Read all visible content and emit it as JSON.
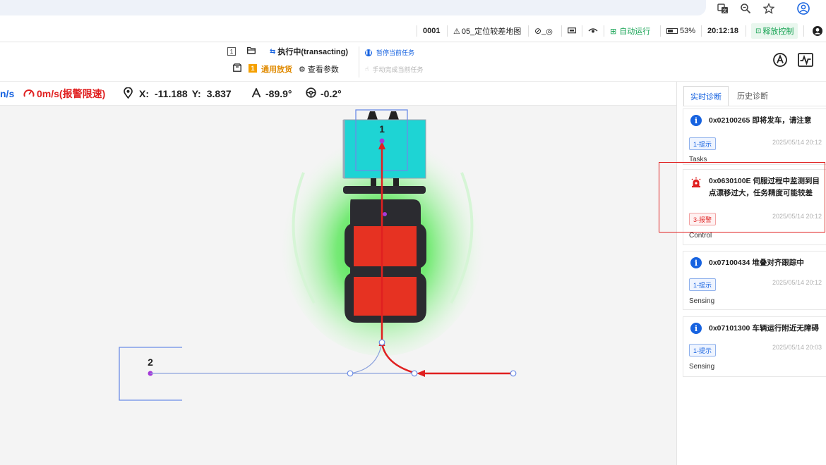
{
  "status_bar": {
    "vehicle_id": "0001",
    "map_name": "05_定位较差地图",
    "site_label": "_",
    "mode": "自动运行",
    "battery": "53%",
    "time": "20:12:18",
    "release_control_label": "释放控制"
  },
  "task_toolbar": {
    "task_index": "1",
    "task_status": "执行中(transacting)",
    "pause_label": "暂停当前任务",
    "manual_complete_label": "手动完成当前任务",
    "step_index": "1",
    "action_label": "通用放货",
    "view_params_label": "查看参数"
  },
  "telemetry": {
    "speed_partial": "n/s",
    "alarm_speed": "0m/s(报警限速)",
    "x_label": "X:",
    "x_value": "-11.188",
    "y_label": "Y:",
    "y_value": "3.837",
    "heading": "-89.9°",
    "steering": "-0.2°"
  },
  "map": {
    "target_1_label": "1",
    "target_2_label": "2",
    "colors": {
      "route": "#e02020",
      "path": "#7a93d8",
      "safety_zone": "#38dd38",
      "cargo": "#1ed4d4",
      "vehicle_body": "#2b2b30",
      "vehicle_panel": "#e63222"
    }
  },
  "diagnostics": {
    "tabs": [
      {
        "label": "实时诊断"
      },
      {
        "label": "历史诊断"
      }
    ],
    "items": [
      {
        "code": "0x02100265 即将发车，请注意",
        "level": "1-提示",
        "time": "2025/05/14 20:12",
        "category": "Tasks"
      },
      {
        "code": "0x0630100E 伺服过程中监测到目点漂移过大，任务精度可能较差",
        "level": "3-报警",
        "time": "2025/05/14 20:12",
        "category": "Control"
      },
      {
        "code": "0x07100434 堆叠对齐跟踪中",
        "level": "1-提示",
        "time": "2025/05/14 20:12",
        "category": "Sensing"
      },
      {
        "code": "0x07101300 车辆运行附近无障碍",
        "level": "1-提示",
        "time": "2025/05/14 20:03",
        "category": "Sensing"
      }
    ]
  }
}
